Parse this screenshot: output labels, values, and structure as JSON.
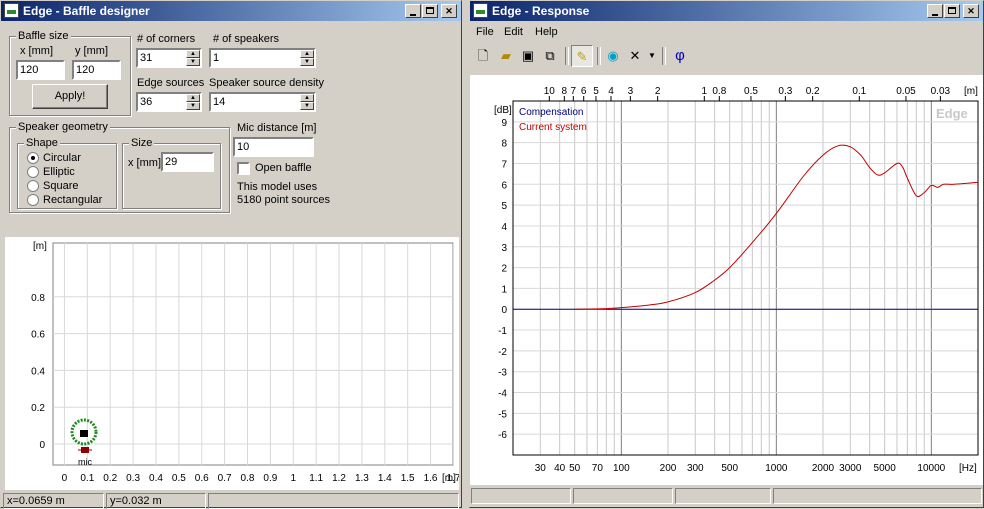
{
  "baffle_window": {
    "title": "Edge - Baffle designer",
    "baffle_size": {
      "group_label": "Baffle size",
      "x_label": "x [mm]",
      "y_label": "y [mm]",
      "x_value": "120",
      "y_value": "120",
      "apply_label": "Apply!"
    },
    "corners": {
      "label": "# of corners",
      "value": "31"
    },
    "speakers": {
      "label": "# of speakers",
      "value": "1"
    },
    "edge_sources": {
      "label": "Edge sources",
      "value": "36"
    },
    "source_density": {
      "label": "Speaker source density",
      "value": "14"
    },
    "geometry": {
      "group_label": "Speaker geometry",
      "shape_label": "Shape",
      "shapes": [
        "Circular",
        "Elliptic",
        "Square",
        "Rectangular"
      ],
      "selected_shape": "Circular",
      "size_label": "Size",
      "size_x_label": "x [mm]",
      "size_x_value": "29"
    },
    "mic": {
      "distance_label": "Mic distance [m]",
      "distance_value": "10",
      "open_baffle_label": "Open baffle",
      "open_baffle_checked": false,
      "model_text_1": "This model uses",
      "model_text_2": "5180 point sources"
    },
    "plot": {
      "unit_x": "[m]",
      "unit_y": "[m]",
      "y_ticks": [
        "0.8",
        "0.6",
        "0.4",
        "0.2",
        "0"
      ],
      "x_ticks": [
        "0",
        "0.1",
        "0.2",
        "0.3",
        "0.4",
        "0.5",
        "0.6",
        "0.7",
        "0.8",
        "0.9",
        "1",
        "1.1",
        "1.2",
        "1.3",
        "1.4",
        "1.5",
        "1.6",
        "1.7"
      ],
      "mic_label": "mic",
      "colors": {
        "baffle": "#1e8a1e",
        "speaker": "#8b0000"
      }
    },
    "status": {
      "x": "x=0.0659 m",
      "y": "y=0.032 m"
    }
  },
  "response_window": {
    "title": "Edge - Response",
    "menu": [
      "File",
      "Edit",
      "Help"
    ],
    "toolbar": {
      "icons": [
        "new-file-icon",
        "open-folder-icon",
        "save-icon",
        "copy-icon",
        "pencil-icon",
        "speaker-icon",
        "delete-icon",
        "dropdown-arrow-icon",
        "phase-icon"
      ],
      "phase_glyph": "φ"
    },
    "watermark": "Edge",
    "legend": {
      "compensation": "Compensation",
      "current": "Current system"
    },
    "colors": {
      "compensation": "#00007f",
      "current": "#c00000"
    }
  },
  "chart_data": {
    "type": "line",
    "xscale": "log",
    "xlabel": "[Hz]",
    "ylabel": "[dB]",
    "top_axis_label": "[m]",
    "xlim": [
      20,
      20000
    ],
    "ylim": [
      -7,
      10
    ],
    "x_tick_labels": [
      "30",
      "40",
      "50",
      "70",
      "100",
      "200",
      "300",
      "500",
      "1000",
      "2000",
      "3000",
      "5000",
      "10000"
    ],
    "x_tick_values": [
      30,
      40,
      50,
      70,
      100,
      200,
      300,
      500,
      1000,
      2000,
      3000,
      5000,
      10000
    ],
    "y_tick_labels": [
      "9",
      "8",
      "7",
      "6",
      "5",
      "4",
      "3",
      "2",
      "1",
      "0",
      "-1",
      "-2",
      "-3",
      "-4",
      "-5",
      "-6"
    ],
    "y_tick_values": [
      9,
      8,
      7,
      6,
      5,
      4,
      3,
      2,
      1,
      0,
      -1,
      -2,
      -3,
      -4,
      -5,
      -6
    ],
    "top_tick_labels": [
      "10",
      "8",
      "7",
      "6",
      "5",
      "4",
      "3",
      "2",
      "1",
      "0.8",
      "0.5",
      "0.3",
      "0.2",
      "0.1",
      "0.05",
      "0.03"
    ],
    "top_tick_values": [
      10,
      8,
      7,
      6,
      5,
      4,
      3,
      2,
      1,
      0.8,
      0.5,
      0.3,
      0.2,
      0.1,
      0.05,
      0.03
    ],
    "grid": true,
    "series": [
      {
        "name": "Compensation",
        "color": "#00007f",
        "x": [
          20,
          20000
        ],
        "y": [
          0,
          0
        ]
      },
      {
        "name": "Current system",
        "color": "#c00000",
        "x": [
          50,
          80,
          100,
          150,
          200,
          300,
          400,
          500,
          700,
          1000,
          1500,
          2000,
          2500,
          3000,
          3500,
          4000,
          4500,
          5000,
          6000,
          6500,
          7000,
          8000,
          9000,
          10000,
          11000,
          12000,
          14000,
          17000,
          20000
        ],
        "y": [
          0,
          0.03,
          0.08,
          0.2,
          0.35,
          0.8,
          1.4,
          2.0,
          3.2,
          4.6,
          6.4,
          7.4,
          7.85,
          7.8,
          7.4,
          6.8,
          6.45,
          6.55,
          7.0,
          6.85,
          6.3,
          5.45,
          5.6,
          5.95,
          5.85,
          6.0,
          6.0,
          6.05,
          6.1
        ]
      }
    ]
  }
}
